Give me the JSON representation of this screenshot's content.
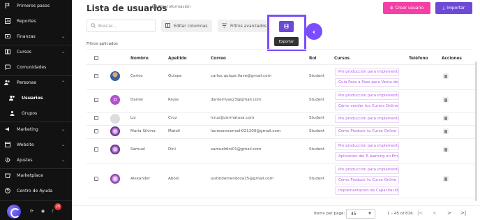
{
  "sidebar": {
    "items": [
      {
        "label": "Primeros pasos",
        "icon": "flag-icon",
        "chevron": ""
      },
      {
        "label": "Reportes",
        "icon": "chart-icon",
        "chevron": ""
      },
      {
        "label": "Finanzas",
        "icon": "finance-icon",
        "chevron": "⌄"
      },
      {
        "label": "Cursos",
        "icon": "book-icon",
        "chevron": "⌄"
      },
      {
        "label": "Comunidades",
        "icon": "community-icon",
        "chevron": ""
      },
      {
        "label": "Personas",
        "icon": "people-icon",
        "chevron": "⌃"
      },
      {
        "label": "Usuarios",
        "icon": "users-icon",
        "chevron": ""
      },
      {
        "label": "Grupos",
        "icon": "groups-icon",
        "chevron": ""
      },
      {
        "label": "Marketing",
        "icon": "megaphone-icon",
        "chevron": "⌄"
      },
      {
        "label": "Website",
        "icon": "website-icon",
        "chevron": "⌄"
      },
      {
        "label": "Ajustes",
        "icon": "settings-icon",
        "chevron": "⌄"
      },
      {
        "label": "Marketplace",
        "icon": "marketplace-icon",
        "chevron": ""
      },
      {
        "label": "Centro de Ayuda",
        "icon": "help-icon",
        "chevron": ""
      }
    ],
    "notification_count": "20"
  },
  "header": {
    "title": "Lista de usuarios",
    "more_info": "Más información",
    "create_label": "Crear usuario",
    "import_label": "Importar"
  },
  "toolbar": {
    "search_placeholder": "Buscar...",
    "columns_label": "Editar columnas",
    "filters_label": "Filtros avanzados",
    "export_tooltip": "Exportar"
  },
  "filters_applied": "Filtros aplicados",
  "table": {
    "columns": [
      "Nombre",
      "Apellido",
      "Correo",
      "Rol",
      "Cursos",
      "Teléfono",
      "Acciones"
    ],
    "rows": [
      {
        "nombre": "Carlos",
        "apellido": "Quispe",
        "correo": "carlos.quispe.llave@gmail.com",
        "rol": "Student",
        "cursos": [
          "Pre producción para implementación de Cursos Online",
          "Guía Paso a Paso para Venta de Cursos Online"
        ]
      },
      {
        "nombre": "Daniel",
        "apellido": "Rivas",
        "correo": "danielrivas23@gmail.com",
        "rol": "Student",
        "cursos": [
          "Pre producción para implementación de Cursos Online",
          "Cómo vender tus Cursos Online"
        ]
      },
      {
        "nombre": "Liz",
        "apellido": "Cruz",
        "correo": "lcruz@zermatusa.com",
        "rol": "Student",
        "cursos": [
          "Pre producción para implementación de Cursos Online"
        ]
      },
      {
        "nombre": "Maria Silvina",
        "apellido": "Matoli",
        "correo": "laureanoconsoli021200@gmail.com",
        "rol": "Student",
        "cursos": [
          "Cómo Producir tu Curso Online"
        ]
      },
      {
        "nombre": "Samuel",
        "apellido": "Dini",
        "correo": "samueldini01@gmail.com",
        "rol": "Student",
        "cursos": [
          "Pre producción para implementación de Cursos Online",
          "Aplicación del E-learning en Empresas"
        ]
      },
      {
        "nombre": "Alexander",
        "apellido": "Abolo",
        "correo": "justindemendoza15@gmail.com",
        "rol": "Student",
        "cursos": [
          "Pre producción para implementación de Cursos Online",
          "Cómo Producir tu Curso Online",
          "Implementación de Capacitación Online"
        ]
      }
    ]
  },
  "pagination": {
    "items_per_page_label": "Items per page:",
    "items_per_page": "45",
    "range": "1 – 45 of 816"
  },
  "colors": {
    "create_btn": "#f43fa6",
    "import_btn": "#6c4ad6",
    "highlight": "#7c4dff",
    "course_text": "#b05ce0"
  }
}
